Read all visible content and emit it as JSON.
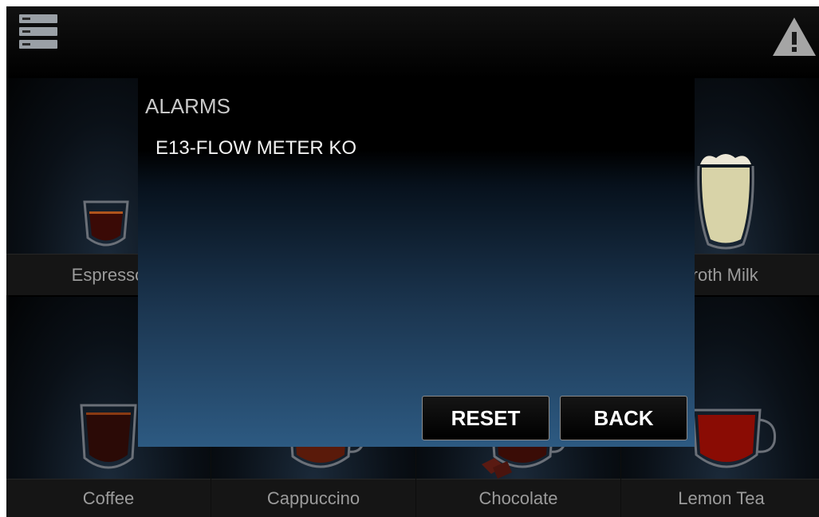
{
  "header": {
    "menu_icon": "menu-list-icon",
    "warning_icon": "warning-triangle-icon"
  },
  "drinks": {
    "espresso": "Espresso",
    "froth_milk": "Froth Milk",
    "coffee": "Coffee",
    "cappuccino": "Cappuccino",
    "chocolate": "Chocolate",
    "lemon_tea": "Lemon Tea"
  },
  "dialog": {
    "title": "ALARMS",
    "alarms": [
      "E13-FLOW METER KO"
    ],
    "reset_label": "RESET",
    "back_label": "BACK"
  },
  "colors": {
    "dialog_gradient_top": "#000000",
    "dialog_gradient_bottom": "#2d5a82",
    "button_border": "#8a8a8a",
    "label_text": "#9b9b9b"
  }
}
